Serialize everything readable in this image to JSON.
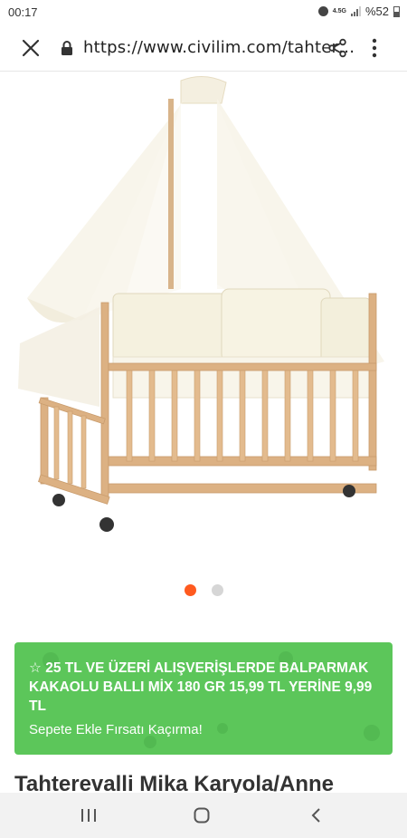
{
  "status_bar": {
    "time": "00:17",
    "network": "4.5G",
    "battery": "%52",
    "icons": [
      "alarm-icon",
      "signal-icon",
      "battery-icon"
    ]
  },
  "browser": {
    "url": "https://www.civilim.com/tahter…",
    "icons": [
      "close-icon",
      "lock-icon",
      "share-icon",
      "more-vert-icon"
    ]
  },
  "carousel": {
    "slide_count": 2,
    "active_index": 0,
    "active_color": "#ff5a1f",
    "inactive_color": "#d6d6d6"
  },
  "promo": {
    "star": "☆",
    "title": "25 TL VE ÜZERİ ALIŞVERİŞLERDE BALPARMAK KAKAOLU BALLI MİX 180 GR 15,99 TL YERİNE 9,99 TL",
    "subtitle": "Sepete Ekle Fırsatı Kaçırma!",
    "bg_color": "#5cc65a"
  },
  "product": {
    "title": "Tahterevalli Mika Karyola/Anne"
  },
  "nav_bar": {
    "icons": [
      "recent-apps-icon",
      "home-icon",
      "back-icon"
    ]
  }
}
